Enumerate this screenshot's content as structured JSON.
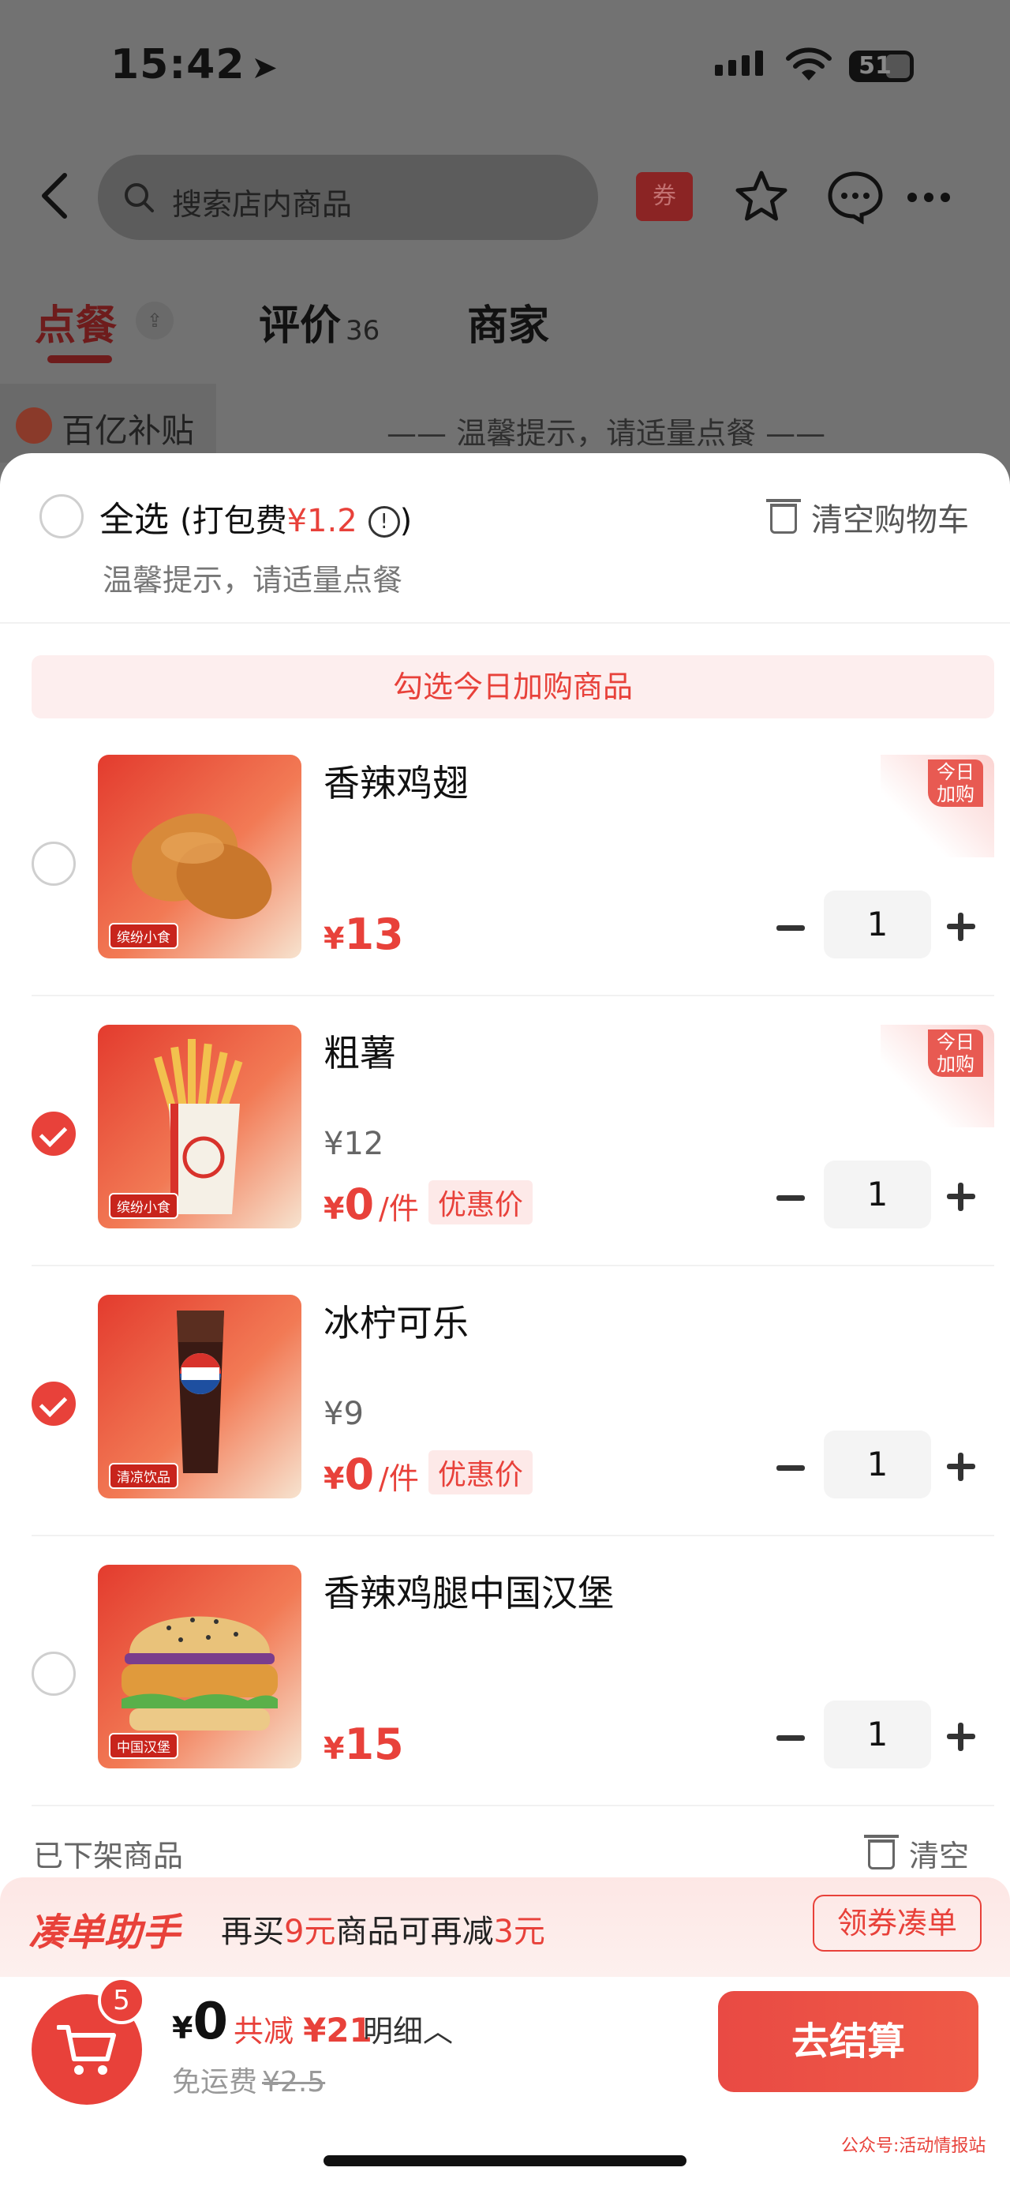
{
  "status_bar": {
    "time": "15:42",
    "battery": "51"
  },
  "header": {
    "search_placeholder": "搜索店内商品",
    "coupon_label": "券"
  },
  "tabs": [
    {
      "label": "点餐",
      "sort_icon": "sort-icon"
    },
    {
      "label": "评价",
      "count": "36"
    },
    {
      "label": "商家"
    }
  ],
  "background_row": {
    "subsidy_label": "百亿补贴",
    "tip": "—— 温馨提示，请适量点餐 ——"
  },
  "cart": {
    "select_all": "全选",
    "packing_prefix": "(打包费",
    "packing_fee": "¥1.2",
    "packing_suffix": ")",
    "clear_cart": "清空购物车",
    "warm_tip": "温馨提示，请适量点餐",
    "banner": "勾选今日加购商品",
    "today_tag": "今日加购",
    "items": [
      {
        "name": "香辣鸡翅",
        "original_price": "",
        "price": "13",
        "unit": "",
        "promo": "",
        "qty": "1",
        "checked": false,
        "today_tag": true,
        "thumb_tag": "缤纷小食"
      },
      {
        "name": "粗薯",
        "original_price": "¥12",
        "price": "0",
        "unit": "/件",
        "promo": "优惠价",
        "qty": "1",
        "checked": true,
        "today_tag": true,
        "thumb_tag": "缤纷小食"
      },
      {
        "name": "冰柠可乐",
        "original_price": "¥9",
        "price": "0",
        "unit": "/件",
        "promo": "优惠价",
        "qty": "1",
        "checked": true,
        "today_tag": false,
        "thumb_tag": "清凉饮品"
      },
      {
        "name": "香辣鸡腿中国汉堡",
        "original_price": "",
        "price": "15",
        "unit": "",
        "promo": "",
        "qty": "1",
        "checked": false,
        "today_tag": false,
        "thumb_tag": "中国汉堡"
      }
    ],
    "currency": "¥",
    "off_shelf": "已下架商品",
    "off_shelf_clear": "清空"
  },
  "helper": {
    "title": "凑单助手",
    "text_1": "再买",
    "amount": "9元",
    "text_2": "商品可再减",
    "discount": "3元",
    "button": "领券凑单"
  },
  "checkout": {
    "badge": "5",
    "currency": "¥",
    "total": "0",
    "saved_label": "共减",
    "saved_amount": "¥21",
    "detail": "明细",
    "delivery_label": "免运费",
    "delivery_original": "¥2.5",
    "button": "去结算"
  },
  "watermark": "公众号:活动情报站",
  "colors": {
    "accent": "#e8413a",
    "promo_bg": "#fde9e8"
  }
}
